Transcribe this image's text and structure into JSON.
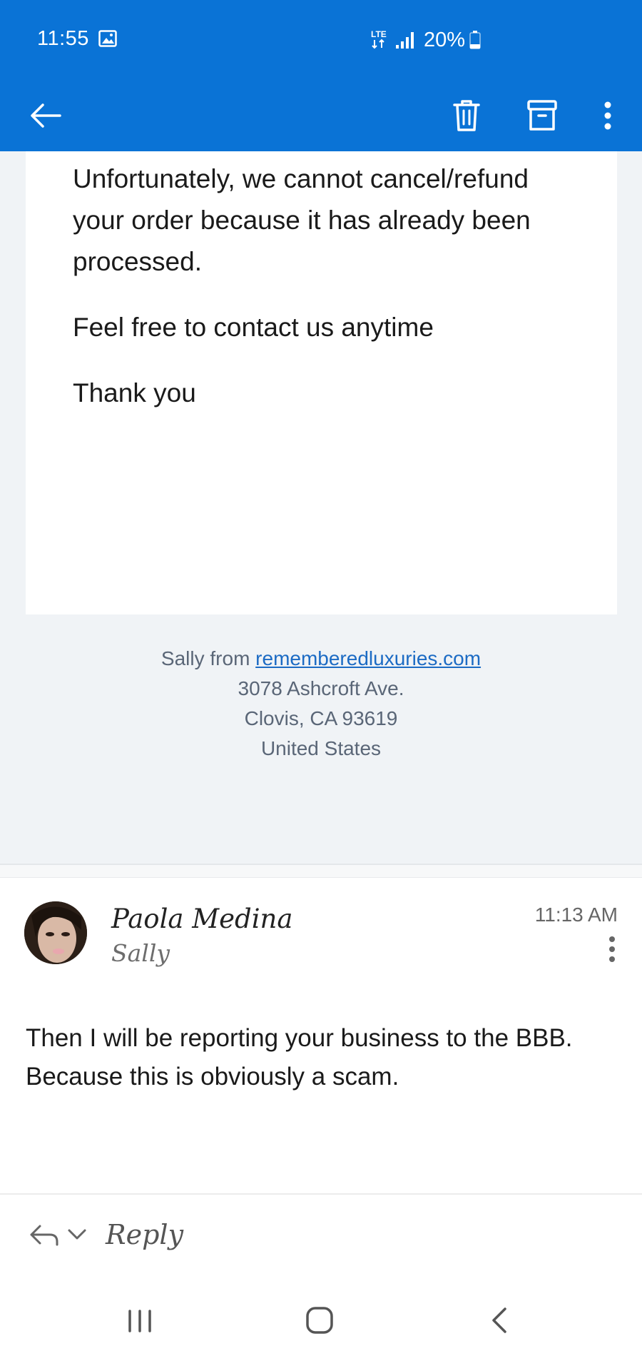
{
  "status_bar": {
    "time": "11:55",
    "network": "LTE",
    "battery": "20%"
  },
  "toolbar": {
    "back_icon": "arrow-left-icon",
    "delete_icon": "trash-icon",
    "archive_icon": "archive-icon",
    "more_icon": "more-vertical-icon"
  },
  "email_body": {
    "paragraph_1": "Unfortunately, we cannot cancel/refund your order because it has already been processed.",
    "paragraph_2": "Feel free to contact us anytime",
    "paragraph_3": "Thank you"
  },
  "footer": {
    "sender_prefix": "Sally from ",
    "sender_link": "rememberedluxuries.com",
    "address_line_1": "3078 Ashcroft Ave.",
    "address_line_2": "Clovis, CA 93619",
    "address_line_3": "United States"
  },
  "message": {
    "sender_name": "Paola Medina",
    "recipient": "Sally",
    "time": "11:13 AM",
    "body": "Then I will be reporting your business to the BBB. Because this is obviously a scam."
  },
  "reply_bar": {
    "label": "Reply"
  },
  "colors": {
    "brand_blue": "#0a73d6",
    "panel_gray": "#f0f3f6",
    "link_blue": "#1c6bc4"
  }
}
